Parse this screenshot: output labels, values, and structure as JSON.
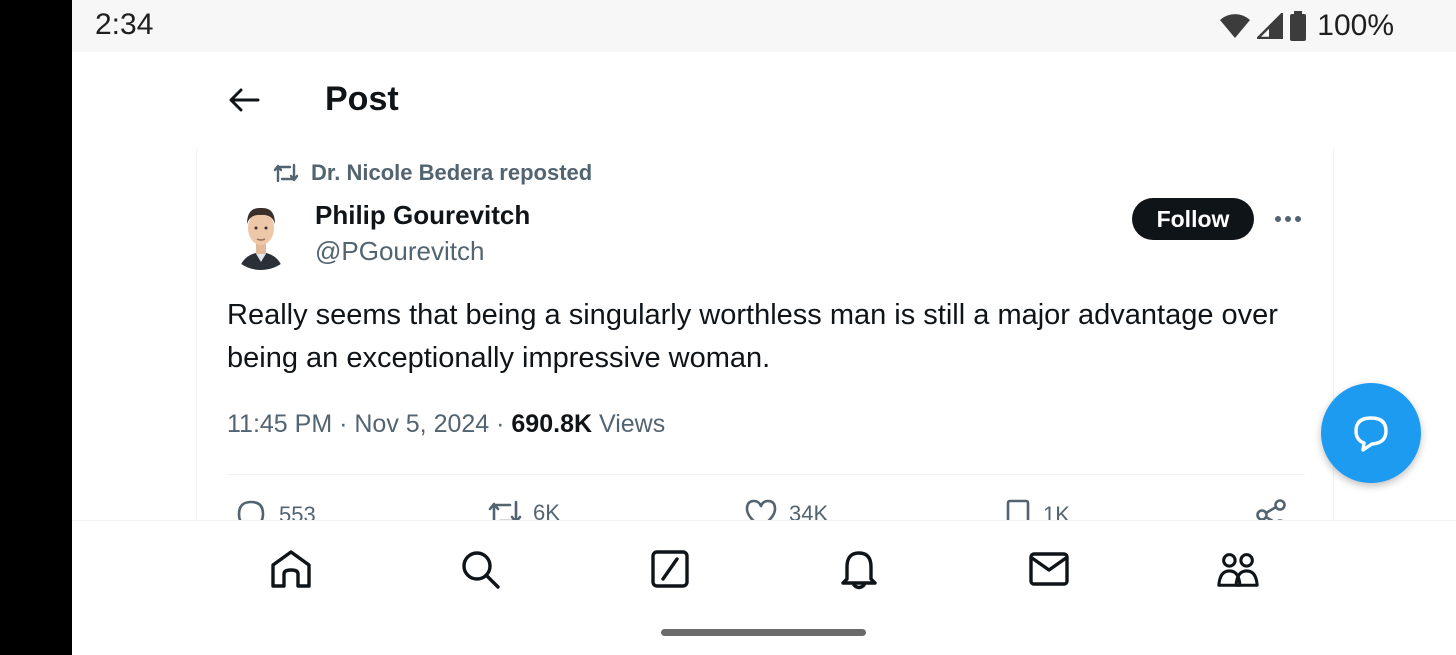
{
  "status_bar": {
    "time": "2:34",
    "battery": "100%",
    "icons": [
      "wifi-icon",
      "cell-signal-icon",
      "battery-icon"
    ]
  },
  "header": {
    "back_icon": "arrow-left-icon",
    "title": "Post"
  },
  "post": {
    "reposted_by": "Dr. Nicole Bedera reposted",
    "author_name": "Philip Gourevitch",
    "author_handle": "@PGourevitch",
    "follow_label": "Follow",
    "text": "Really seems that being a singularly worthless man is still a major advantage over being an exceptionally impressive woman.",
    "timestamp": "11:45 PM · Nov 5, 2024 · ",
    "views_count": "690.8K",
    "views_label": " Views",
    "actions": {
      "replies": "553",
      "reposts": "6K",
      "likes": "34K",
      "bookmarks": "1K"
    }
  },
  "colors": {
    "accent": "#1d9bf0",
    "text_primary": "#0f1419",
    "text_secondary": "#536471",
    "divider": "#eff3f4"
  },
  "bottom_nav": {
    "items": [
      "home-icon",
      "search-icon",
      "grok-icon",
      "notifications-icon",
      "messages-icon",
      "communities-icon"
    ]
  }
}
